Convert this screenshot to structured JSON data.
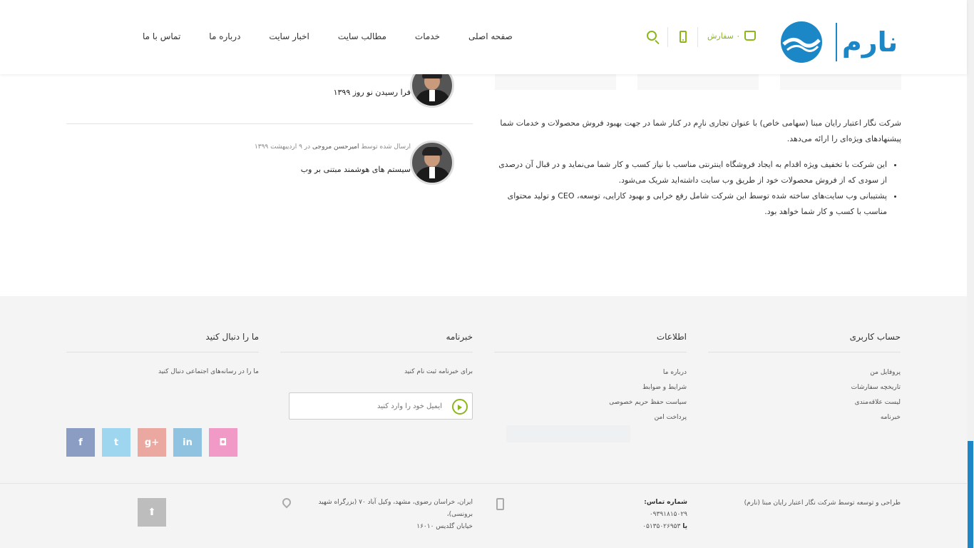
{
  "header": {
    "cart_label": "۰ سفارش",
    "nav": [
      {
        "label": "صفحه اصلی"
      },
      {
        "label": "خدمات"
      },
      {
        "label": "مطالب سایت"
      },
      {
        "label": "اخبار سایت"
      },
      {
        "label": "درباره ما"
      },
      {
        "label": "تماس با ما"
      }
    ],
    "logo_text": "نارم"
  },
  "about": {
    "intro": "شرکت نگار اعتبار رایان مبنا (سهامی خاص) با عنوان تجاری نارِم در کنار شما در جهت بهبود فروش محصولات و خدمات شما پیشنهادهای ویژه‌ای را ارائه می‌دهد.",
    "bullets": [
      "این شرکت با تخفیف ویژه اقدام به ایجاد فروشگاه اینترنتی مناسب با نیاز کسب و کار شما می‌نماید و در قبال آن درصدی از سودی که از فروش محصولات خود از طریق وب سایت داشته‌اید شریک می‌شود.",
      "پشتیبانی وب سایت‌های ساخته شده توسط این شرکت شامل رفع خرابی و بهبود کارایی، توسعه، CEO و تولید محتوای مناسب با کسب و کار شما خواهد بود."
    ]
  },
  "posts": [
    {
      "meta_prefix": "",
      "author": "",
      "meta_date": "",
      "title": "فرا رسیدن نو روز ۱۳۹۹"
    },
    {
      "meta_prefix": "ارسال شده توسط",
      "author": "امیرحسن مروجی",
      "meta_date": "در ۹ اردیبهشت ۱۳۹۹",
      "title": "سیستم های هوشمند مبتنی بر وب"
    }
  ],
  "footer": {
    "account": {
      "title": "حساب کاربری",
      "links": [
        "پروفایل من",
        "تاریخچه سفارشات",
        "لیست علاقه‌مندی",
        "خبرنامه"
      ]
    },
    "info": {
      "title": "اطلاعات",
      "links": [
        "درباره ما",
        "شرایط و ضوابط",
        "سیاست حفظ حریم خصوصی",
        "پرداخت امن"
      ]
    },
    "newsletter": {
      "title": "خبرنامه",
      "desc": "برای خبرنامه ثبت نام کنید",
      "placeholder": "ایمیل خود را وارد کنید"
    },
    "follow": {
      "title": "ما را دنبال کنید",
      "desc": "ما را در رسانه‌های اجتماعی دنبال کنید",
      "icons": [
        {
          "name": "facebook-icon",
          "glyph": "f",
          "color": "#8b9dc3"
        },
        {
          "name": "twitter-icon",
          "glyph": "t",
          "color": "#9fd6ef"
        },
        {
          "name": "google-plus-icon",
          "glyph": "g+",
          "color": "#eaa8a0"
        },
        {
          "name": "linkedin-icon",
          "glyph": "in",
          "color": "#8fc3e0"
        },
        {
          "name": "instagram-icon",
          "glyph": "◘",
          "color": "#f19ac8"
        }
      ]
    }
  },
  "bottom": {
    "copyright": "طراحی و توسعه توسط شرکت نگار اعتبار رایان مبنا (نارم)",
    "contact_label": "شماره تماس:",
    "phone1": "۰۹۳۹۱۸۱۵۰۲۹",
    "or_label": "یا",
    "phone2": "۰۵۱۳۵۰۲۶۹۵۳",
    "address_line1": "ایران، خراسان رضوی، مشهد، وکیل آباد ۷۰ (بزرگراه شهید برونسی)،",
    "address_line2": "خیابان گلدیس ۱۶۰۱۰",
    "top_button": "⬆"
  },
  "colors": {
    "accent": "#8bb71d",
    "brand_blue": "#1b87c7"
  }
}
